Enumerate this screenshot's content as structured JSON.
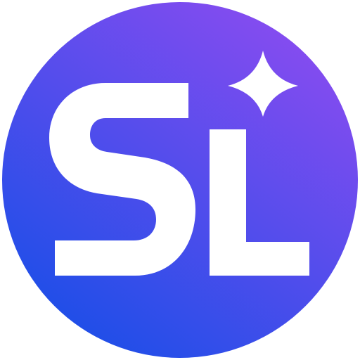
{
  "logo": {
    "lettering": "SL",
    "icon": "sparkle-star-icon",
    "colors": {
      "gradient_top_right": "#8a4cf0",
      "gradient_bottom_left": "#1d4ee8",
      "glyph": "#ffffff"
    }
  }
}
